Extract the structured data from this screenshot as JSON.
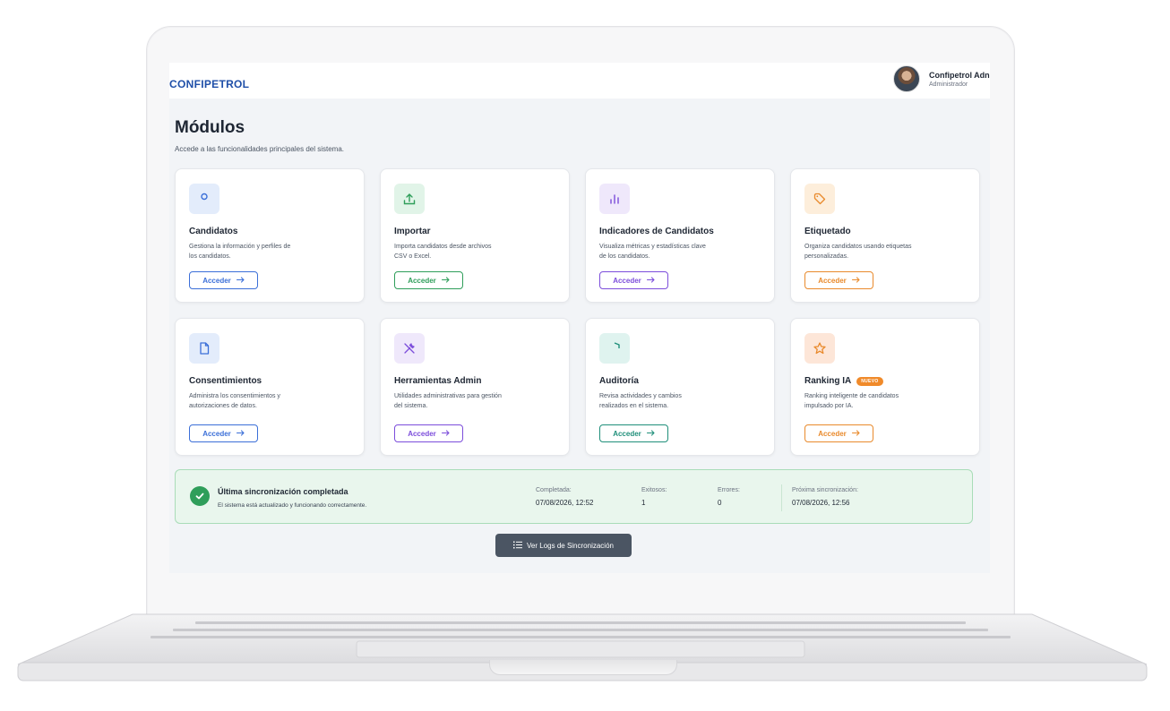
{
  "header": {
    "logo_text": "CONFIPETROL",
    "user_name": "Confipetrol Adn",
    "user_role": "Administrador"
  },
  "page": {
    "title": "Módulos",
    "subtitle": "Accede a las funcionalidades principales del sistema."
  },
  "modules": [
    {
      "title": "Candidatos",
      "desc": "Gestiona la información y perfiles de los candidatos.",
      "button": "Acceder",
      "icon": "user-icon",
      "color": "#3b6fd8",
      "bg": "#e3ecfb"
    },
    {
      "title": "Importar",
      "desc": "Importa candidatos desde archivos CSV o Excel.",
      "button": "Acceder",
      "icon": "upload-icon",
      "color": "#2f9e5a",
      "bg": "#e1f4e8"
    },
    {
      "title": "Indicadores de Candidatos",
      "desc": "Visualiza métricas y estadísticas clave de los candidatos.",
      "button": "Acceder",
      "icon": "bar-chart-icon",
      "color": "#7c4ddb",
      "bg": "#efe8fb"
    },
    {
      "title": "Etiquetado",
      "desc": "Organiza candidatos usando etiquetas personalizadas.",
      "button": "Acceder",
      "icon": "tag-icon",
      "color": "#e98a2c",
      "bg": "#fdeedb"
    },
    {
      "title": "Consentimientos",
      "desc": "Administra los consentimientos y autorizaciones de datos.",
      "button": "Acceder",
      "icon": "document-icon",
      "color": "#3b6fd8",
      "bg": "#e3ecfb"
    },
    {
      "title": "Herramientas Admin",
      "desc": "Utilidades administrativas para gestión del sistema.",
      "button": "Acceder",
      "icon": "tools-icon",
      "color": "#7c4ddb",
      "bg": "#efe8fb"
    },
    {
      "title": "Auditoría",
      "desc": "Revisa actividades y cambios realizados en el sistema.",
      "button": "Acceder",
      "icon": "shield-icon",
      "color": "#1f8f7a",
      "bg": "#dff3ef"
    },
    {
      "title": "Ranking IA",
      "badge": "NUEVO",
      "desc": "Ranking inteligente de candidatos impulsado por IA.",
      "button": "Acceder",
      "icon": "star-icon",
      "color": "#e98a2c",
      "bg": "#fde6d8"
    }
  ],
  "sync": {
    "title": "Última sincronización completada",
    "subtitle": "El sistema está actualizado y funcionando correctamente.",
    "completed_label": "Completada:",
    "completed_value": "07/08/2026, 12:52",
    "success_label": "Exitosos:",
    "success_value": "1",
    "errors_label": "Errores:",
    "errors_value": "0",
    "next_label": "Próxima sincronización:",
    "next_value": "07/08/2026, 12:56"
  },
  "logs_button": "Ver Logs de Sincronización"
}
